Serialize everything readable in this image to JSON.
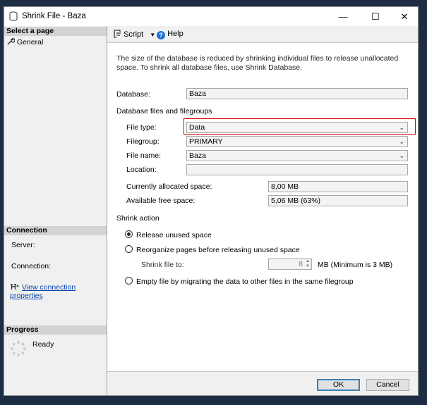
{
  "window": {
    "title": "Shrink File - Baza",
    "minimize": "—",
    "maximize": "☐",
    "close": "✕"
  },
  "left": {
    "select_page": "Select a page",
    "pages": [
      {
        "label": "General",
        "icon": "wrench-icon"
      }
    ],
    "connection_header": "Connection",
    "server_label": "Server:",
    "connection_label": "Connection:",
    "view_connection": "View connection properties",
    "progress_header": "Progress",
    "progress_status": "Ready"
  },
  "toolbar": {
    "script": "Script",
    "help": "Help"
  },
  "main": {
    "description": "The size of the database is reduced by shrinking individual files to release unallocated space. To shrink all database files, use Shrink Database.",
    "database_label": "Database:",
    "database_value": "Baza",
    "files_section": "Database files and filegroups",
    "file_type_label": "File type:",
    "file_type_value": "Data",
    "filegroup_label": "Filegroup:",
    "filegroup_value": "PRIMARY",
    "file_name_label": "File name:",
    "file_name_value": "Baza",
    "location_label": "Location:",
    "location_value": "",
    "allocated_label": "Currently allocated space:",
    "allocated_value": "8,00 MB",
    "free_label": "Available free space:",
    "free_value": "5,06 MB (63%)",
    "shrink_action": "Shrink action",
    "opt_release": "Release unused space",
    "opt_reorganize": "Reorganize pages before releasing unused space",
    "shrink_to_label": "Shrink file to:",
    "shrink_to_value": "8",
    "shrink_to_unit": "MB (Minimum is 3 MB)",
    "opt_empty": "Empty file by migrating the data to other files in the same filegroup",
    "selected_option": "release"
  },
  "buttons": {
    "ok": "OK",
    "cancel": "Cancel"
  },
  "colors": {
    "highlight": "#d40000",
    "link": "#0645ad"
  }
}
